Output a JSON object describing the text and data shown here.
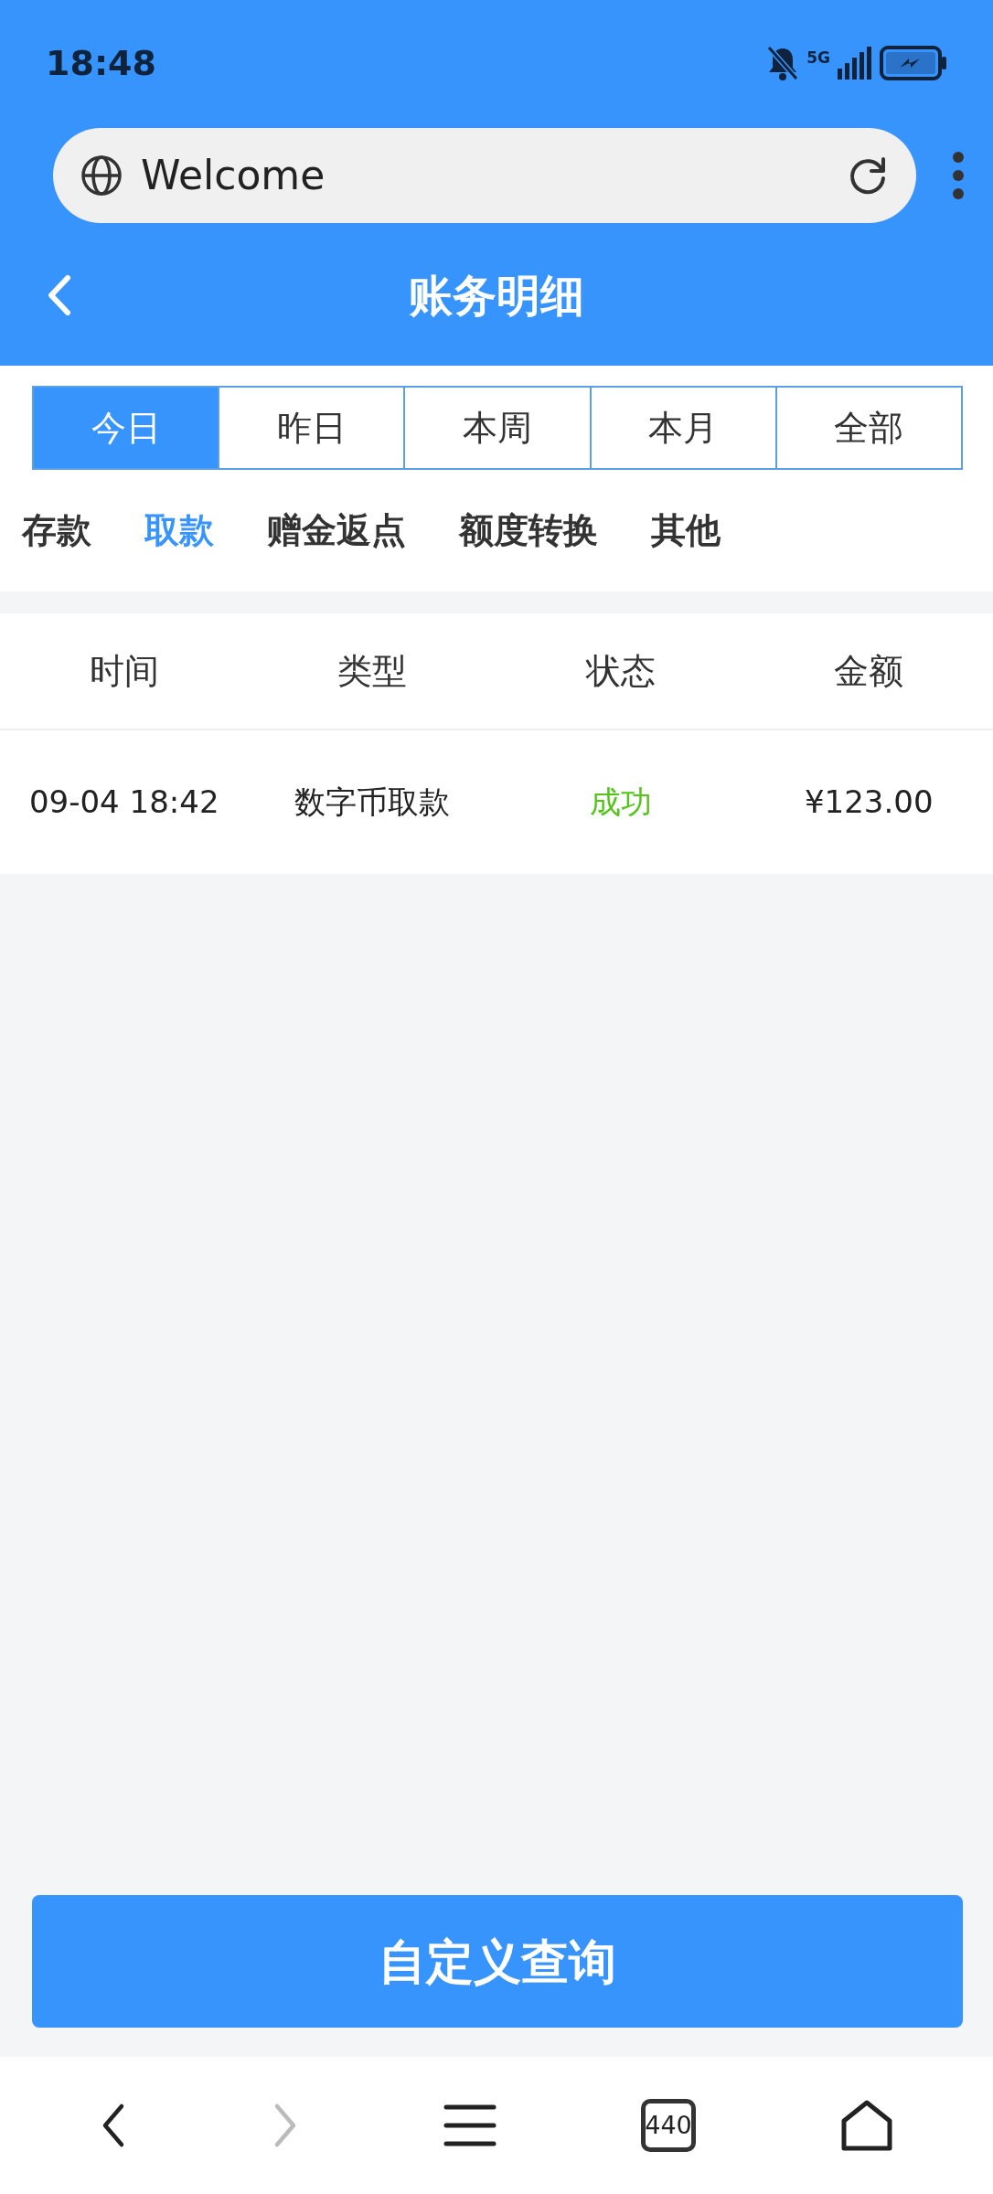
{
  "status_bar": {
    "time": "18:48",
    "network": "5G"
  },
  "browser": {
    "page_title": "Welcome"
  },
  "header": {
    "title": "账务明细"
  },
  "period_tabs": [
    {
      "label": "今日",
      "selected": true
    },
    {
      "label": "昨日",
      "selected": false
    },
    {
      "label": "本周",
      "selected": false
    },
    {
      "label": "本月",
      "selected": false
    },
    {
      "label": "全部",
      "selected": false
    }
  ],
  "category_tabs": [
    {
      "label": "存款",
      "selected": false
    },
    {
      "label": "取款",
      "selected": true
    },
    {
      "label": "赠金返点",
      "selected": false
    },
    {
      "label": "额度转换",
      "selected": false
    },
    {
      "label": "其他",
      "selected": false
    }
  ],
  "table": {
    "columns": [
      "时间",
      "类型",
      "状态",
      "金额"
    ],
    "rows": [
      {
        "time": "09-04 18:42",
        "type": "数字币取款",
        "status": "成功",
        "color": "#52c41a",
        "amount": "¥123.00"
      }
    ]
  },
  "query_button": "自定义查询",
  "bottom_nav": {
    "back_disabled": false,
    "forward_disabled": true,
    "tab_count": "440"
  }
}
